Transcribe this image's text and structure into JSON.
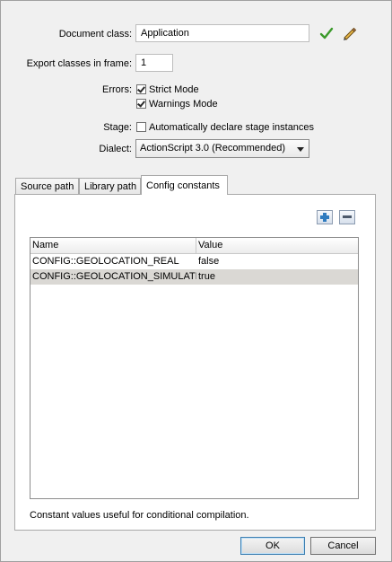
{
  "form": {
    "document_class_label": "Document class:",
    "document_class_value": "Application",
    "export_classes_label": "Export classes in frame:",
    "export_classes_value": "1",
    "errors_label": "Errors:",
    "strict_mode_label": "Strict Mode",
    "warnings_mode_label": "Warnings Mode",
    "stage_label": "Stage:",
    "auto_declare_label": "Automatically declare stage instances",
    "dialect_label": "Dialect:",
    "dialect_value": "ActionScript 3.0 (Recommended)",
    "strict_mode_checked": true,
    "warnings_mode_checked": true,
    "auto_declare_checked": false
  },
  "icons": {
    "validate": "checkmark-icon",
    "edit": "pencil-icon",
    "add": "plus-icon",
    "remove": "minus-icon"
  },
  "tabs": [
    {
      "label": "Source path"
    },
    {
      "label": "Library path"
    },
    {
      "label": "Config constants",
      "active": true
    }
  ],
  "table": {
    "columns": [
      "Name",
      "Value"
    ],
    "rows": [
      {
        "name": "CONFIG::GEOLOCATION_REAL",
        "value": "false"
      },
      {
        "name": "CONFIG::GEOLOCATION_SIMULATE",
        "value": "true"
      }
    ]
  },
  "hint": "Constant values useful for conditional compilation.",
  "buttons": {
    "ok": "OK",
    "cancel": "Cancel"
  },
  "colors": {
    "check_green": "#3a9a2a",
    "selected_row": "#dad8d4",
    "add_cross": "#2f7bbf"
  }
}
